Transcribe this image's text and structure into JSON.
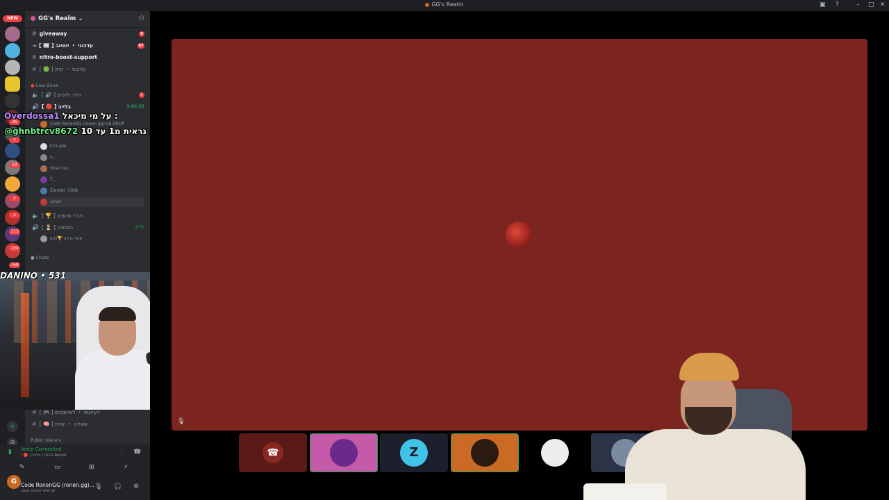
{
  "window": {
    "title": "GG's Realm"
  },
  "server": {
    "name": "GG's Realm ⌄",
    "new_badge": "NEW"
  },
  "rail_badges": [
    "36",
    "4",
    "19",
    "2",
    "1",
    "113",
    "134",
    "768"
  ],
  "channels": [
    {
      "name": "giveaway",
      "badge": "9",
      "bright": true
    },
    {
      "name": "[ 📰 ] עדכוני ・ יוטיוב",
      "badge": "67",
      "bright": true
    },
    {
      "name": "nitro-boost-support",
      "badge": "",
      "bright": true
    },
    {
      "name": "[ 🟢 ] עדכוני ・ קיק",
      "badge": "",
      "bright": false
    }
  ],
  "categories": {
    "live": "Live Zone",
    "chats": "Chats",
    "public": "Public Voice's"
  },
  "live_channels": [
    {
      "name": "[ 🔊 ] חדר לייבים",
      "badge": "1"
    },
    {
      "name": "[ 🔴 ] בלייב",
      "time": "3:05:53"
    }
  ],
  "voice_users": [
    {
      "name": "Code RonenGG (ronen.gg)",
      "tag": "LB  DROP"
    },
    {
      "name": "kira",
      "tag": "jew"
    },
    {
      "name": "o...",
      "tag": ""
    },
    {
      "name": "Shai",
      "tag": "גננת"
    },
    {
      "name": "T...",
      "tag": ""
    },
    {
      "name": "Zanetti",
      "tag": "⚡SUB"
    },
    {
      "name": "זינגזונג",
      "tag": ""
    }
  ],
  "voice_channels2": [
    {
      "name": "[ 🏆 ] חברי מועדון"
    },
    {
      "name": "[ ⏳ ] המתנה",
      "time": "4:55"
    }
  ],
  "voice_user2": {
    "name": "אסף גרניט",
    "tag": "🏆גזען"
  },
  "chat_channels": [
    {
      "name": "[ 🎮 ] רעיונות ・ לאיוונטים"
    },
    {
      "name": "[ 🧠 ] שאלה ・ יומית"
    }
  ],
  "overlay_chat": [
    {
      "user": "Overdossa1",
      "text": "על מי מיכאל :"
    },
    {
      "user": "@ghnbtrcv8672",
      "text": "איך היא נראית מ1 עד 10 :"
    }
  ],
  "webcam_label": "DANINO • 531",
  "voice_status": {
    "title": "Voice Connected",
    "sub": "[ 🔴 ] בלייב / GG's Realm"
  },
  "user": {
    "name": "Code RonenGG (ronen.gg)...",
    "status": "יום שישי המבוא אגוגג"
  },
  "tiles": [
    {
      "color": "#5a1a17",
      "icon": "phone-icon"
    },
    {
      "color": "#c45aa8",
      "icon": "avatar"
    },
    {
      "color": "#1c1f2c",
      "icon": "logo-z-icon"
    },
    {
      "color": "#c96a25",
      "icon": "avatar"
    },
    {
      "color": "#000000",
      "icon": "avatar"
    },
    {
      "color": "#2b3446",
      "icon": "avatar"
    }
  ]
}
